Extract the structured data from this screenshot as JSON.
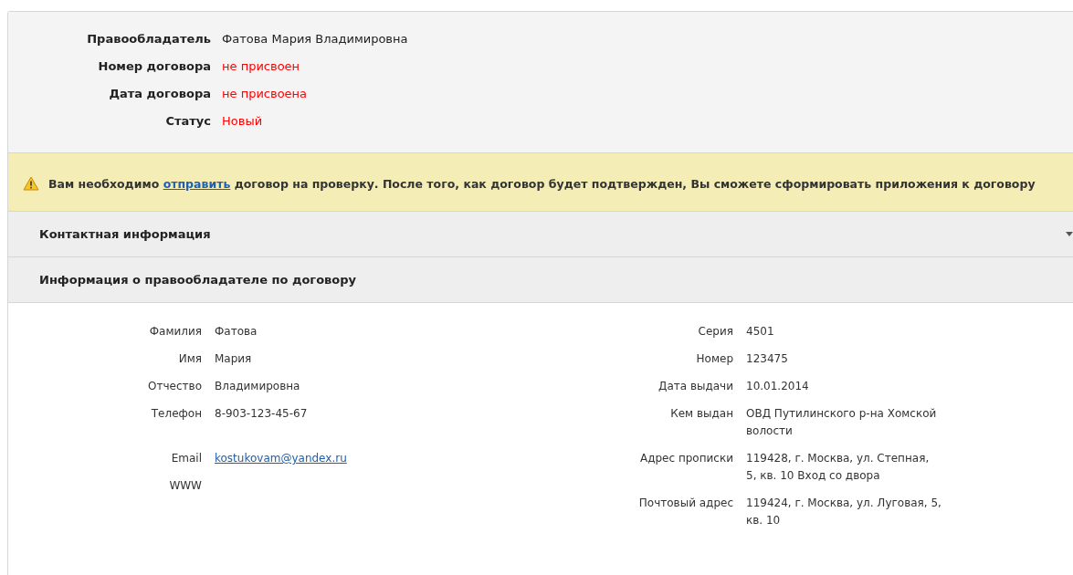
{
  "summary": [
    {
      "label": "Правообладатель",
      "value": "Фатова Мария Владимировна",
      "kind": "plain"
    },
    {
      "label": "Номер договора",
      "value": "не присвоен",
      "kind": "alert"
    },
    {
      "label": "Дата договора",
      "value": "не присвоена",
      "kind": "alert"
    },
    {
      "label": "Статус",
      "value": "Новый",
      "kind": "alert"
    }
  ],
  "warning": {
    "before": "Вам необходимо",
    "link": "отправить",
    "after": "договор на проверку. После того, как договор будет подтвержден, Вы сможете сформировать приложения к договору"
  },
  "sections": [
    {
      "title": "Контактная информация",
      "collapsible": true
    },
    {
      "title": "Информация о правообладателе по договору",
      "collapsible": false
    }
  ],
  "left_fields": [
    {
      "label": "Фамилия",
      "value": "Фатова"
    },
    {
      "label": "Имя",
      "value": "Мария"
    },
    {
      "label": "Отчество",
      "value": "Владимировна"
    },
    {
      "label": "Телефон",
      "value": "8-903-123-45-67"
    },
    {
      "label": "Email",
      "value": "kostukovam@yandex.ru",
      "kind": "link"
    },
    {
      "label": "WWW"
    }
  ],
  "right_fields": [
    {
      "label": "Серия",
      "value": "4501"
    },
    {
      "label": "Номер",
      "value": "123475"
    },
    {
      "label": "Дата выдачи",
      "value": "10.01.2014"
    },
    {
      "label": "Кем выдан",
      "value": "ОВД Путилинского р-на Хомской волости"
    },
    {
      "label": "Адрес прописки",
      "value": "119428, г. Москва, ул. Степная, 5, кв. 10 Вход со двора"
    },
    {
      "label": "Почтовый адрес",
      "value": "119424, г. Москва, ул. Луговая, 5, кв. 10"
    }
  ]
}
